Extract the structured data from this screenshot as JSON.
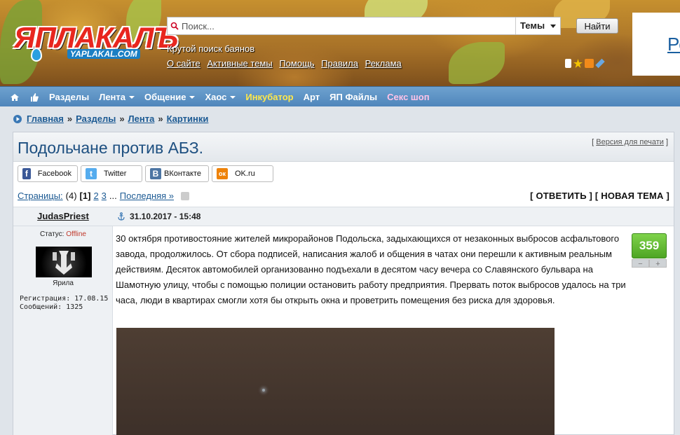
{
  "header": {
    "logo_text": "ЯПЛАКАЛЪ",
    "logo_sub": "YAPLAKAL.COM",
    "search_placeholder": "Поиск...",
    "search_scope": "Темы",
    "search_button": "Найти",
    "tagline": "Крутой поиск баянов",
    "links": [
      "О сайте",
      "Активные темы",
      "Помощь",
      "Правила",
      "Реклама"
    ],
    "right_teaser": "Ре"
  },
  "nav": {
    "items": [
      {
        "label": "Разделы",
        "dropdown": false,
        "color": "#ffffff"
      },
      {
        "label": "Лента",
        "dropdown": true,
        "color": "#ffffff"
      },
      {
        "label": "Общение",
        "dropdown": true,
        "color": "#ffffff"
      },
      {
        "label": "Хаос",
        "dropdown": true,
        "color": "#ffffff"
      },
      {
        "label": "Инкубатор",
        "dropdown": false,
        "color": "#ffe84a"
      },
      {
        "label": "Арт",
        "dropdown": false,
        "color": "#ffffff"
      },
      {
        "label": "ЯП Файлы",
        "dropdown": false,
        "color": "#ffffff"
      },
      {
        "label": "Секс шоп",
        "dropdown": false,
        "color": "#ffc3e8"
      }
    ]
  },
  "breadcrumb": [
    "Главная",
    "Разделы",
    "Лента",
    "Картинки"
  ],
  "topic": {
    "title": "Подольчане против АБЗ.",
    "print_open": "[",
    "print_link": "Версия для печати",
    "print_close": "]"
  },
  "share": [
    {
      "label": "Facebook",
      "icon": "facebook-icon",
      "color": "#3b5998",
      "glyph": "f"
    },
    {
      "label": "Twitter",
      "icon": "twitter-icon",
      "color": "#55acee",
      "glyph": "t"
    },
    {
      "label": "ВКонтакте",
      "icon": "vk-icon",
      "color": "#4c75a3",
      "glyph": "B"
    },
    {
      "label": "OK.ru",
      "icon": "ok-icon",
      "color": "#ee8208",
      "glyph": "ок"
    }
  ],
  "pagination": {
    "label": "Страницы:",
    "total": "(4)",
    "current": "[1]",
    "pages": [
      "2",
      "3"
    ],
    "ellipsis": "...",
    "last": "Последняя »"
  },
  "actions": {
    "reply": "[ ОТВЕТИТЬ ]",
    "new_topic": "[ НОВАЯ ТЕМА ]"
  },
  "post": {
    "author": "JudasPriest",
    "date": "31.10.2017 - 15:48",
    "status_label": "Статус:",
    "status_value": "Offline",
    "avatar_caption": "Ярила",
    "reg_label": "Регистрация:",
    "reg_value": "17.08.15",
    "posts_label": "Сообщений:",
    "posts_value": "1325",
    "rating": "359",
    "rating_minus": "−",
    "rating_plus": "+",
    "body": "30 октября противостояние жителей микрорайонов Подольска, задыхающихся от незаконных выбросов асфальтового завода, продолжилось. От сбора подписей, написания жалоб и общения в чатах они перешли к активным реальным действиям. Десяток автомобилей организованно подъехали в десятом часу вечера со Славянского бульвара на Шамотную улицу, чтобы с помощью полиции остановить работу предприятия. Прервать поток выбросов удалось на три часа, люди в квартирах смогли хотя бы открыть окна и проветрить помещения без риска для здоровья."
  }
}
